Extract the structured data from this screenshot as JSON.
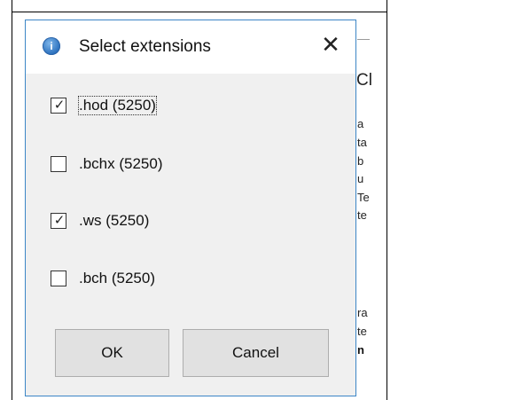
{
  "background": {
    "heading": "Cl",
    "lines": [
      "a",
      "ta",
      "b",
      "u",
      "Te",
      "te",
      "",
      "ra",
      "te",
      "n"
    ]
  },
  "dialog": {
    "title": "Select extensions",
    "title_icon": "info-icon",
    "close_glyph": "✕",
    "options": [
      {
        "label": ".hod (5250)",
        "checked": true,
        "focused": true
      },
      {
        "label": ".bchx (5250)",
        "checked": false,
        "focused": false
      },
      {
        "label": ".ws (5250)",
        "checked": true,
        "focused": false
      },
      {
        "label": ".bch (5250)",
        "checked": false,
        "focused": false
      }
    ],
    "ok_label": "OK",
    "cancel_label": "Cancel"
  },
  "colors": {
    "dialog_border": "#3c86c6",
    "dialog_body": "#f0f0f0",
    "button_face": "#e1e1e1",
    "button_border": "#adadad"
  }
}
